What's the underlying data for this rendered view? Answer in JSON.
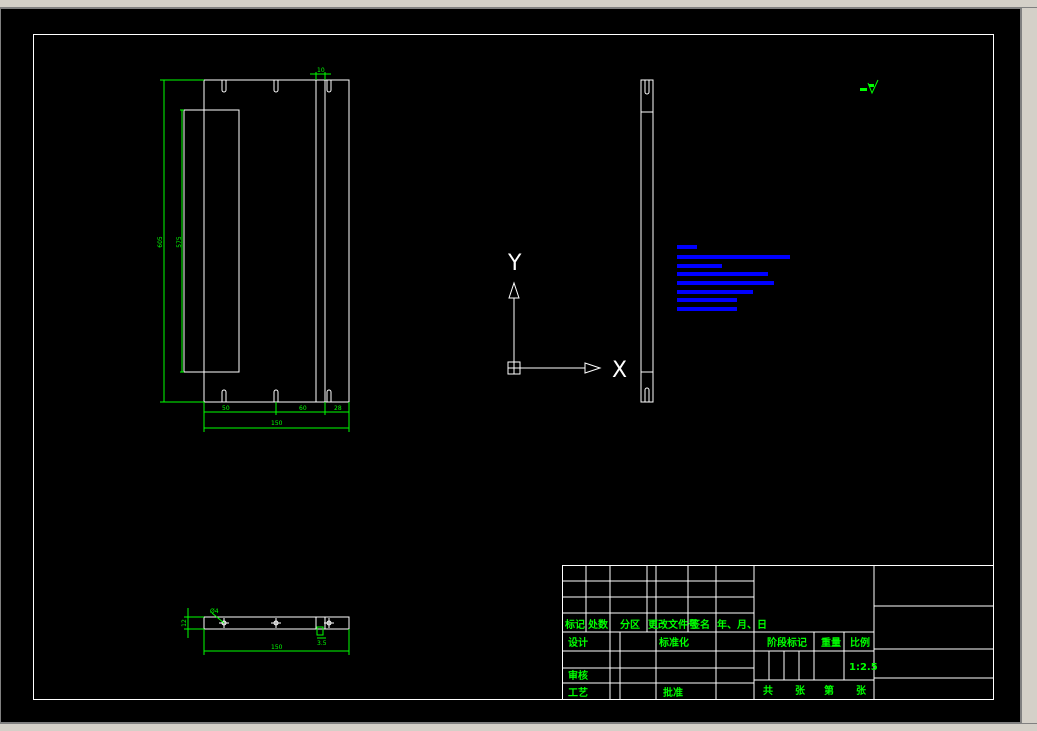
{
  "window": {
    "colors": {
      "background": "#000000",
      "frame": "#ffffff",
      "dimension": "#00ff00",
      "notes": "#0000ff",
      "chrome": "#d4d0c8"
    }
  },
  "drawing": {
    "front_view": {
      "dims": {
        "height_overall": "605",
        "height_slot": "575",
        "width_overall": "150",
        "seg_1": "50",
        "seg_2": "60",
        "seg_3": "28",
        "top_small": "10"
      }
    },
    "bottom_view": {
      "dims": {
        "height": "12",
        "width": "150",
        "hole": "Ø4",
        "small": "3.5"
      }
    },
    "ucs": {
      "x_label": "X",
      "y_label": "Y"
    },
    "roughness_symbol": "roughness-symbol"
  },
  "title_block": {
    "headers": [
      "标记",
      "处数",
      "分区",
      "更改文件号",
      "签名",
      "年、月、日"
    ],
    "row_design": "设计",
    "row_standard": "标准化",
    "row_review": "审核",
    "row_process": "工艺",
    "row_approve": "批准",
    "stage_mark": "阶段标记",
    "weight": "重量",
    "scale_label": "比例",
    "scale_value": "1:2.5",
    "sheet_total": "共",
    "sheet_unit_a": "张",
    "sheet_no": "第",
    "sheet_unit_b": "张"
  }
}
